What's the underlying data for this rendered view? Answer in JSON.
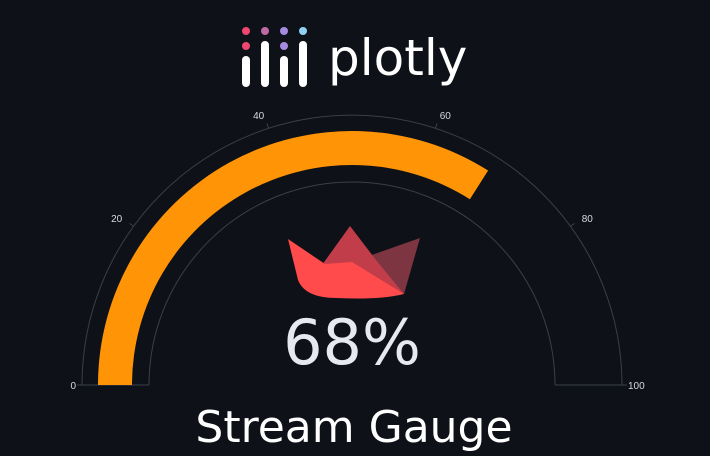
{
  "brand": {
    "name": "plotly",
    "logo_icon": "plotly-bars-icon",
    "dot_colors": [
      "#ef476f",
      "#c06aa5",
      "#a58be0",
      "#8fd1f2"
    ]
  },
  "gauge": {
    "title": "Stream Gauge",
    "value": 68,
    "value_display": "68%",
    "range": [
      0,
      100
    ],
    "tick_values": [
      0,
      20,
      40,
      60,
      80,
      100
    ],
    "tick_labels": [
      "0",
      "20",
      "40",
      "60",
      "80",
      "100"
    ],
    "bar_color": "#ff9406",
    "axis_line_color": "#3b3f49",
    "center_icon": "streamlit-crown-icon",
    "crown_colors": [
      "#ff4b4b",
      "#c23d4a",
      "#7d3542"
    ]
  },
  "chart_data": {
    "type": "gauge",
    "title": "Stream Gauge",
    "value": 68,
    "unit": "%",
    "range": [
      0,
      100
    ],
    "ticks": [
      0,
      20,
      40,
      60,
      80,
      100
    ],
    "bar_color": "#ff9406"
  }
}
